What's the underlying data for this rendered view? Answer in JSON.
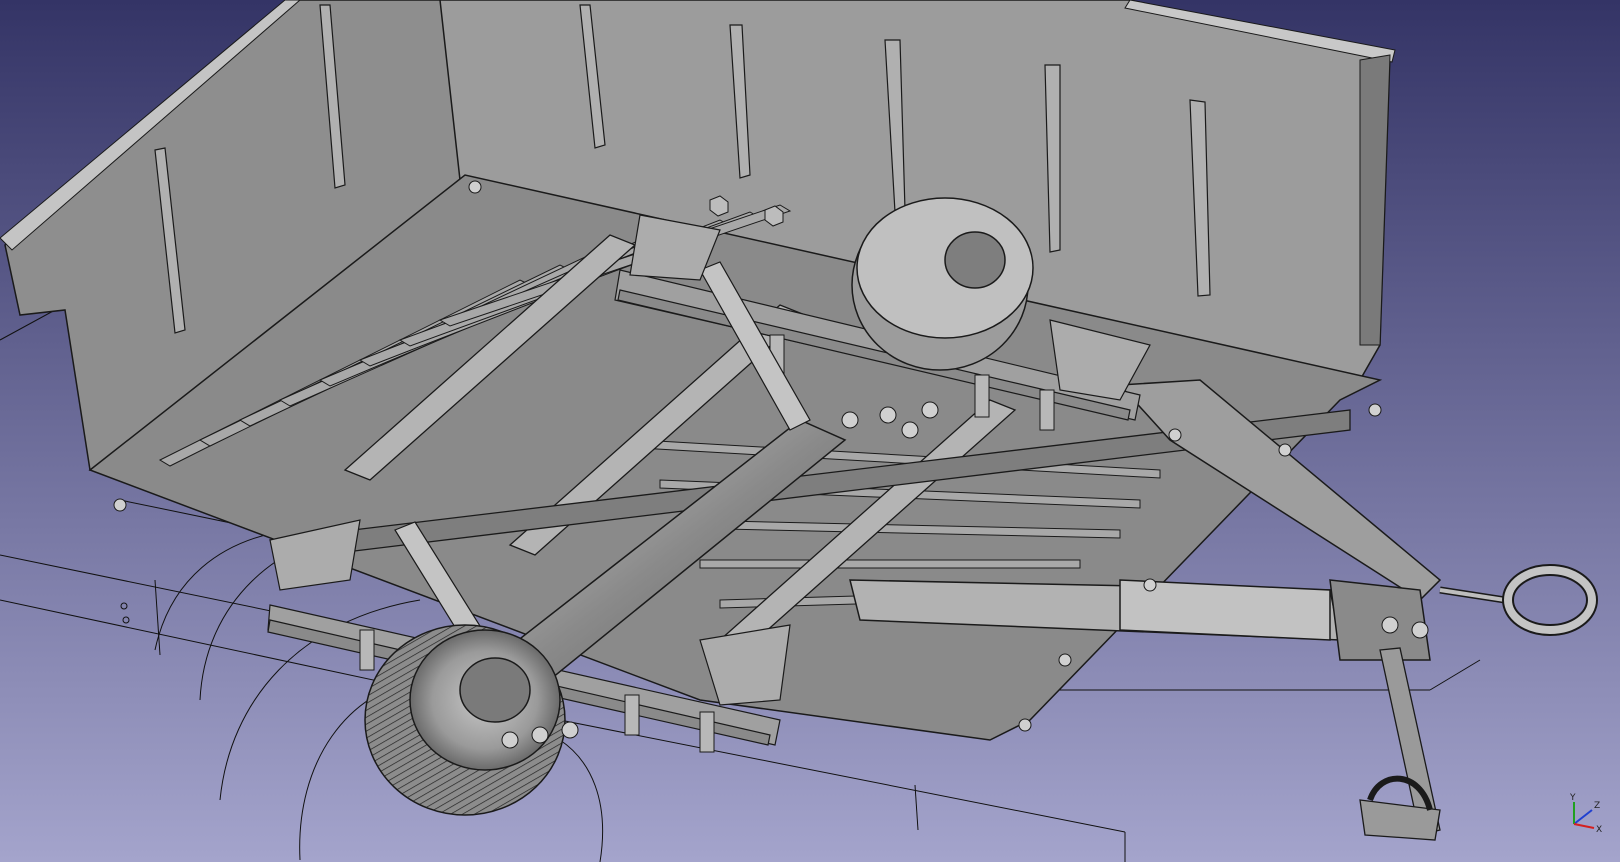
{
  "view": {
    "bg_top": "#343466",
    "bg_bottom": "#a4a4cc"
  },
  "model": {
    "body_fill": "#9a9a9a",
    "body_light": "#b8b8b8",
    "body_dark": "#6e6e6e",
    "edge": "#1a1a1a",
    "sketch_line": "#111111"
  },
  "axis": {
    "x_label": "X",
    "y_label": "Y",
    "z_label": "Z",
    "x_color": "#d42020",
    "y_color": "#20a020",
    "z_color": "#2040d0"
  }
}
